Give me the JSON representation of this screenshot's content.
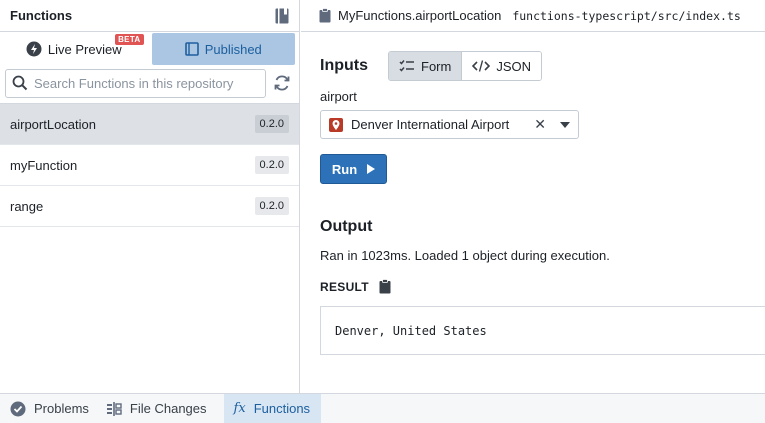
{
  "left_panel": {
    "title": "Functions",
    "tabs": [
      {
        "label": "Live Preview",
        "badge": "BETA",
        "active": false
      },
      {
        "label": "Published",
        "active": true
      }
    ],
    "search": {
      "placeholder": "Search Functions in this repository",
      "value": ""
    },
    "functions": [
      {
        "name": "airportLocation",
        "version": "0.2.0",
        "selected": true
      },
      {
        "name": "myFunction",
        "version": "0.2.0",
        "selected": false
      },
      {
        "name": "range",
        "version": "0.2.0",
        "selected": false
      }
    ]
  },
  "right_panel": {
    "file_title": "MyFunctions.airportLocation",
    "file_path": "functions-typescript/src/index.ts",
    "inputs": {
      "title": "Inputs",
      "modes": [
        {
          "label": "Form",
          "active": true
        },
        {
          "label": "JSON",
          "active": false
        }
      ],
      "field_label": "airport",
      "field_value": "Denver International Airport"
    },
    "run_label": "Run",
    "output": {
      "title": "Output",
      "info": "Ran in 1023ms. Loaded 1 object during execution.",
      "result_label": "RESULT",
      "result_value": "Denver, United States"
    }
  },
  "bottom_bar": {
    "tabs": [
      {
        "label": "Problems",
        "icon": "check-circle-icon",
        "active": false
      },
      {
        "label": "File Changes",
        "icon": "diff-icon",
        "active": false
      },
      {
        "label": "Functions",
        "icon": "fx-icon",
        "active": true
      }
    ]
  },
  "colors": {
    "accent": "#2d72b8",
    "accent_text": "#1c5f9e",
    "selected_tab": "#abc6e3",
    "beta": "#e05454",
    "pin": "#b83a27"
  }
}
